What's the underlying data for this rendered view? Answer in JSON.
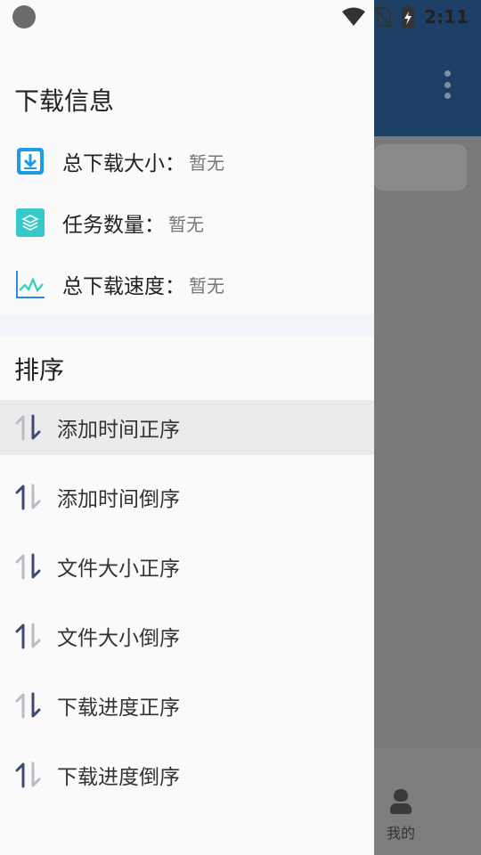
{
  "status_bar": {
    "time": "2:11",
    "icons": [
      "wifi-icon",
      "no-sim-icon",
      "battery-charging-icon"
    ]
  },
  "background": {
    "bottom_nav": {
      "mine_label": "我的"
    }
  },
  "drawer": {
    "info_section": {
      "title": "下载信息",
      "items": [
        {
          "icon": "download-box-icon",
          "label": "总下载大小：",
          "value": "暂无"
        },
        {
          "icon": "layers-icon",
          "label": "任务数量：",
          "value": "暂无"
        },
        {
          "icon": "chart-line-icon",
          "label": "总下载速度：",
          "value": "暂无"
        }
      ]
    },
    "sort_section": {
      "title": "排序",
      "items": [
        {
          "label": "添加时间正序",
          "direction": "asc",
          "selected": true
        },
        {
          "label": "添加时间倒序",
          "direction": "desc",
          "selected": false
        },
        {
          "label": "文件大小正序",
          "direction": "asc",
          "selected": false
        },
        {
          "label": "文件大小倒序",
          "direction": "desc",
          "selected": false
        },
        {
          "label": "下载进度正序",
          "direction": "asc",
          "selected": false
        },
        {
          "label": "下载进度倒序",
          "direction": "desc",
          "selected": false
        }
      ]
    }
  },
  "colors": {
    "toolbar": "#1e3f66",
    "scrim": "#7a7a7a",
    "drawer_bg": "#fafafa",
    "icon_dark": "#3f4a73",
    "icon_light": "#b9bcc4",
    "download_icon": "#1e9be8",
    "layers_icon": "#36c9c9",
    "chart_icon": "#2d8be0"
  }
}
